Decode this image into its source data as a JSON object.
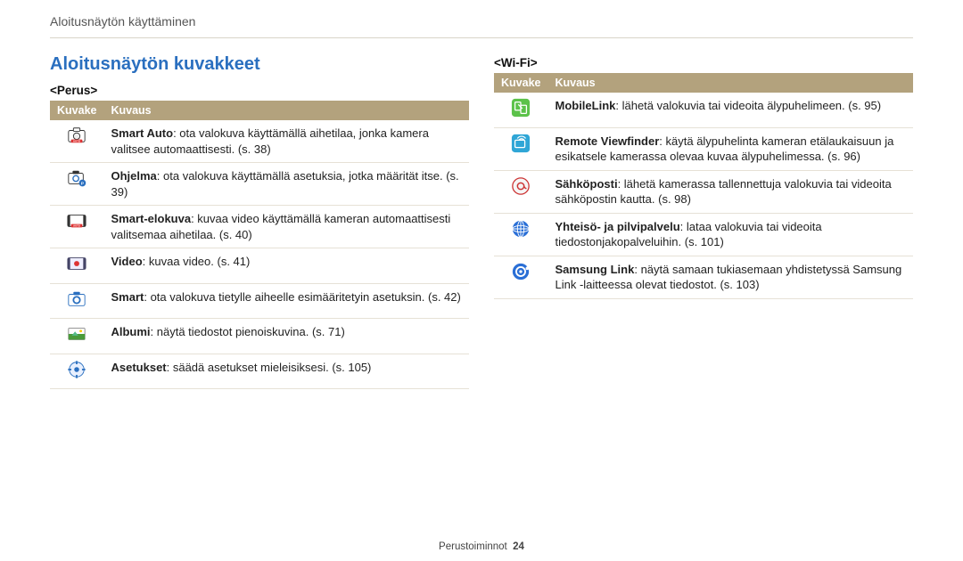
{
  "breadcrumb": "Aloitusnäytön käyttäminen",
  "main_heading": "Aloitusnäytön kuvakkeet",
  "footer": {
    "section": "Perustoiminnot",
    "page": "24"
  },
  "left": {
    "title": "<Perus>",
    "th_icon": "Kuvake",
    "th_desc": "Kuvaus",
    "rows": [
      {
        "icon": "smart-auto",
        "term": "Smart Auto",
        "text": ": ota valokuva käyttämällä aihetilaa, jonka kamera valitsee automaattisesti. (s. 38)"
      },
      {
        "icon": "program",
        "term": "Ohjelma",
        "text": ": ota valokuva käyttämällä asetuksia, jotka määrität itse. (s. 39)"
      },
      {
        "icon": "smart-movie",
        "term": "Smart-elokuva",
        "text": ": kuvaa video käyttämällä kameran automaattisesti valitsemaa aihetilaa. (s. 40)"
      },
      {
        "icon": "video",
        "term": "Video",
        "text": ": kuvaa video. (s. 41)"
      },
      {
        "icon": "smart",
        "term": "Smart",
        "text": ": ota valokuva tietylle aiheelle esimääritetyin asetuksin. (s. 42)"
      },
      {
        "icon": "album",
        "term": "Albumi",
        "text": ": näytä tiedostot pienoiskuvina. (s. 71)"
      },
      {
        "icon": "settings",
        "term": "Asetukset",
        "text": ": säädä asetukset mieleisiksesi. (s. 105)"
      }
    ]
  },
  "right": {
    "title": "<Wi-Fi>",
    "th_icon": "Kuvake",
    "th_desc": "Kuvaus",
    "rows": [
      {
        "icon": "mobilelink",
        "term": "MobileLink",
        "text": ": lähetä valokuvia tai videoita älypuhelimeen. (s. 95)"
      },
      {
        "icon": "viewfinder",
        "term": "Remote Viewfinder",
        "text": ": käytä älypuhelinta kameran etälaukaisuun ja esikatsele kamerassa olevaa kuvaa älypuhelimessa. (s. 96)"
      },
      {
        "icon": "email",
        "term": "Sähköposti",
        "text": ": lähetä kamerassa tallennettuja valokuvia tai videoita sähköpostin kautta. (s. 98)"
      },
      {
        "icon": "cloud",
        "term": "Yhteisö- ja pilvipalvelu",
        "text": ": lataa valokuvia tai videoita tiedostonjakopalveluihin. (s. 101)"
      },
      {
        "icon": "samsung-link",
        "term": "Samsung Link",
        "text": ": näytä samaan tukiasemaan yhdistetyssä Samsung Link -laitteessa olevat tiedostot. (s. 103)"
      }
    ]
  }
}
